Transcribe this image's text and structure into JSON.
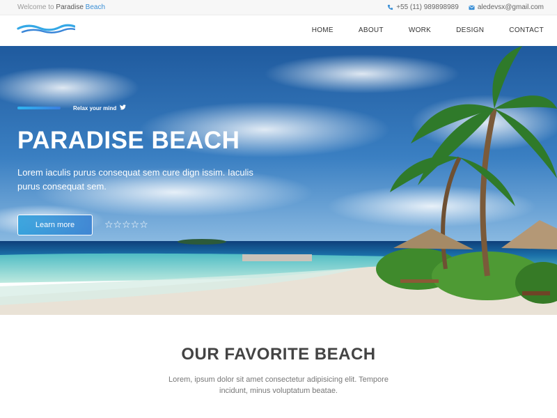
{
  "topbar": {
    "welcome_prefix": "Welcome to",
    "welcome_brand": "Paradise",
    "welcome_accent": "Beach",
    "phone": "+55 (11) 989898989",
    "email": "aledevsx@gmail.com"
  },
  "nav": {
    "items": [
      "HOME",
      "ABOUT",
      "WORK",
      "DESIGN",
      "CONTACT"
    ]
  },
  "hero": {
    "tagline": "Relax your mind",
    "title": "PARADISE BEACH",
    "subtitle": "Lorem iaculis purus consequat sem cure dign issim. Iaculis purus consequat sem.",
    "button_label": "Learn more",
    "stars": "☆☆☆☆☆"
  },
  "section": {
    "title": "OUR FAVORITE BEACH",
    "text": "Lorem, ipsum dolor sit amet consectetur adipisicing elit. Tempore incidunt, minus voluptatum beatae."
  },
  "colors": {
    "accent": "#3a8fd6",
    "accent_gradient_start": "#2fb6f0",
    "accent_gradient_end": "#3a7ee0"
  }
}
